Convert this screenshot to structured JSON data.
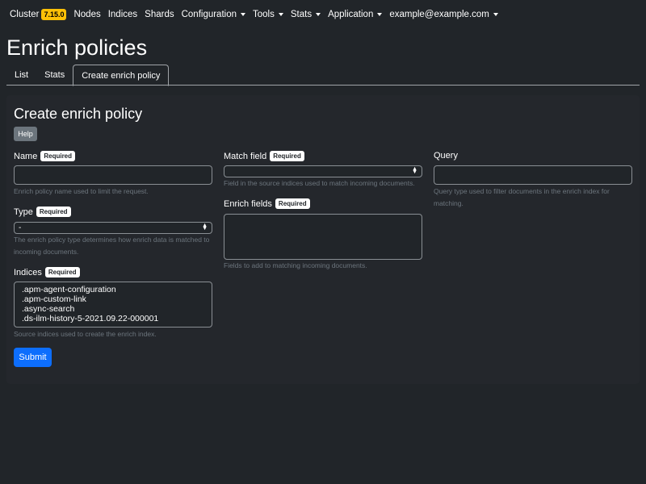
{
  "nav": {
    "brand": "Cluster",
    "version": "7.15.0",
    "items": [
      {
        "label": "Nodes",
        "dropdown": false
      },
      {
        "label": "Indices",
        "dropdown": false
      },
      {
        "label": "Shards",
        "dropdown": false
      },
      {
        "label": "Configuration",
        "dropdown": true
      },
      {
        "label": "Tools",
        "dropdown": true
      },
      {
        "label": "Stats",
        "dropdown": true
      },
      {
        "label": "Application",
        "dropdown": true
      },
      {
        "label": "example@example.com",
        "dropdown": true
      }
    ]
  },
  "page_title": "Enrich policies",
  "tabs": [
    {
      "label": "List"
    },
    {
      "label": "Stats"
    },
    {
      "label": "Create enrich policy",
      "active": true
    }
  ],
  "form": {
    "title": "Create enrich policy",
    "help": "Help",
    "required": "Required",
    "name": {
      "label": "Name",
      "value": "",
      "hint": "Enrich policy name used to limit the request."
    },
    "type": {
      "label": "Type",
      "value": "-",
      "hint": "The enrich policy type determines how enrich data is matched to incoming documents."
    },
    "indices": {
      "label": "Indices",
      "options": [
        ".apm-agent-configuration",
        ".apm-custom-link",
        ".async-search",
        ".ds-ilm-history-5-2021.09.22-000001"
      ],
      "hint": "Source indices used to create the enrich index."
    },
    "match_field": {
      "label": "Match field",
      "value": "",
      "hint": "Field in the source indices used to match incoming documents."
    },
    "enrich_fields": {
      "label": "Enrich fields",
      "value": "",
      "hint": "Fields to add to matching incoming documents."
    },
    "query": {
      "label": "Query",
      "value": "",
      "hint": "Query type used to filter documents in the enrich index for matching."
    },
    "submit": "Submit"
  },
  "colors": {
    "background": "#212529",
    "primary": "#0d6efd",
    "badge": "#ffc107"
  }
}
